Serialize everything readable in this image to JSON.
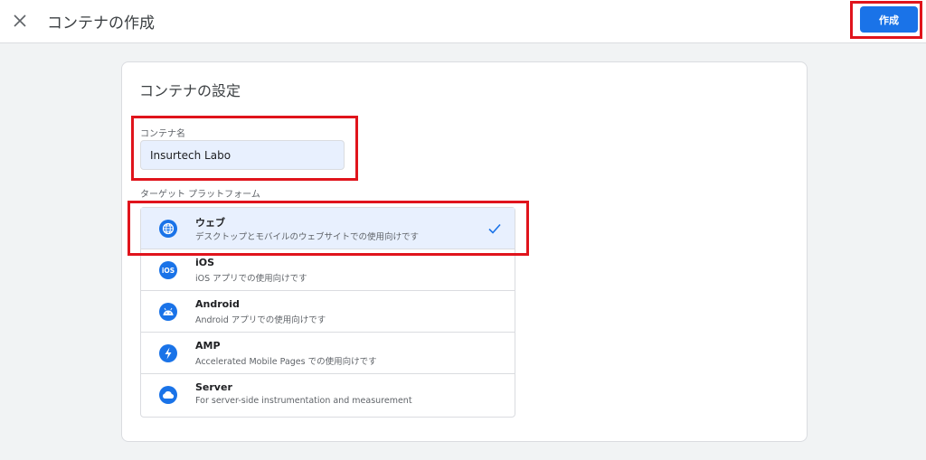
{
  "header": {
    "title": "コンテナの作成",
    "create_label": "作成",
    "close_icon": "close-icon"
  },
  "card": {
    "title": "コンテナの設定",
    "name_label": "コンテナ名",
    "name_value": "Insurtech Labo",
    "platform_label": "ターゲット プラットフォーム"
  },
  "platforms": [
    {
      "name": "ウェブ",
      "desc": "デスクトップとモバイルのウェブサイトでの使用向けです",
      "icon": "globe-icon",
      "selected": true
    },
    {
      "name": "iOS",
      "desc": "iOS アプリでの使用向けです",
      "icon": "ios-icon",
      "selected": false
    },
    {
      "name": "Android",
      "desc": "Android アプリでの使用向けです",
      "icon": "android-icon",
      "selected": false
    },
    {
      "name": "AMP",
      "desc": "Accelerated Mobile Pages での使用向けです",
      "icon": "amp-icon",
      "selected": false
    },
    {
      "name": "Server",
      "desc": "For server-side instrumentation and measurement",
      "icon": "cloud-icon",
      "selected": false
    }
  ],
  "colors": {
    "accent": "#1a73e8",
    "highlight": "#e0141c",
    "selected_bg": "#e8f0fe"
  }
}
